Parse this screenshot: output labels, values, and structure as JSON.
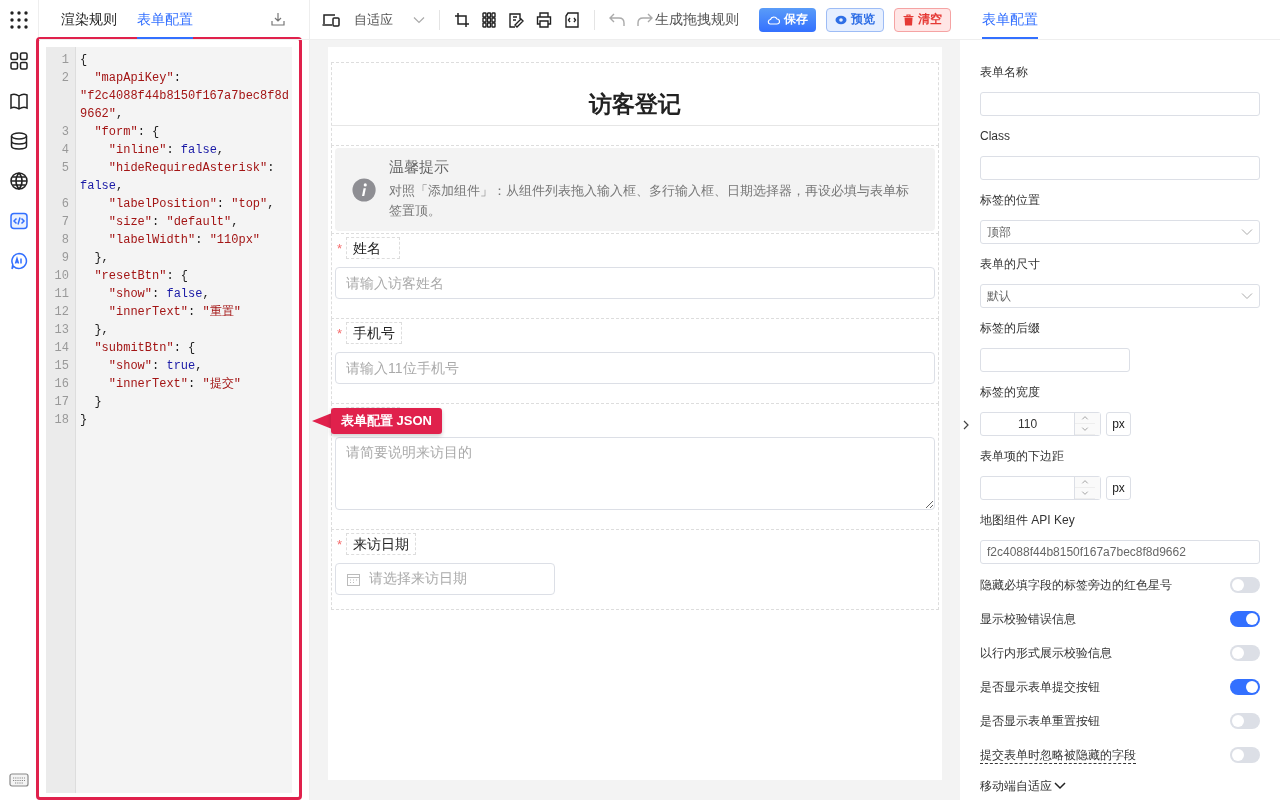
{
  "rail": {
    "items": [
      {
        "selected": false
      },
      {
        "selected": false
      },
      {
        "selected": false
      },
      {
        "selected": false
      },
      {
        "selected": true
      },
      {
        "selected": false
      }
    ]
  },
  "left_panel": {
    "tabs": [
      {
        "label": "渲染规则",
        "selected": false
      },
      {
        "label": "表单配置",
        "selected": true
      }
    ]
  },
  "code_editor": {
    "lines": [
      {
        "number": "1",
        "tokens": [
          {
            "kind": "punct",
            "text": "{"
          }
        ]
      },
      {
        "number": "2",
        "tokens": [
          {
            "kind": "key",
            "text": "  \"mapApiKey\""
          },
          {
            "kind": "punct",
            "text": ": "
          },
          {
            "kind": "string",
            "text": "\"f2c4088f44b8150f167a7bec8f8d9662\""
          },
          {
            "kind": "punct",
            "text": ","
          }
        ]
      },
      {
        "number": "3",
        "tokens": [
          {
            "kind": "key",
            "text": "  \"form\""
          },
          {
            "kind": "punct",
            "text": ": {"
          }
        ]
      },
      {
        "number": "4",
        "tokens": [
          {
            "kind": "key",
            "text": "    \"inline\""
          },
          {
            "kind": "punct",
            "text": ": "
          },
          {
            "kind": "literal",
            "text": "false"
          },
          {
            "kind": "punct",
            "text": ","
          }
        ]
      },
      {
        "number": "5",
        "tokens": [
          {
            "kind": "key",
            "text": "    \"hideRequiredAsterisk\""
          },
          {
            "kind": "punct",
            "text": ": "
          },
          {
            "kind": "literal",
            "text": "false"
          },
          {
            "kind": "punct",
            "text": ","
          }
        ]
      },
      {
        "number": "6",
        "tokens": [
          {
            "kind": "key",
            "text": "    \"labelPosition\""
          },
          {
            "kind": "punct",
            "text": ": "
          },
          {
            "kind": "string",
            "text": "\"top\""
          },
          {
            "kind": "punct",
            "text": ","
          }
        ]
      },
      {
        "number": "7",
        "tokens": [
          {
            "kind": "key",
            "text": "    \"size\""
          },
          {
            "kind": "punct",
            "text": ": "
          },
          {
            "kind": "string",
            "text": "\"default\""
          },
          {
            "kind": "punct",
            "text": ","
          }
        ]
      },
      {
        "number": "8",
        "tokens": [
          {
            "kind": "key",
            "text": "    \"labelWidth\""
          },
          {
            "kind": "punct",
            "text": ": "
          },
          {
            "kind": "string",
            "text": "\"110px\""
          }
        ]
      },
      {
        "number": "9",
        "tokens": [
          {
            "kind": "punct",
            "text": "  },"
          }
        ]
      },
      {
        "number": "10",
        "tokens": [
          {
            "kind": "key",
            "text": "  \"resetBtn\""
          },
          {
            "kind": "punct",
            "text": ": {"
          }
        ]
      },
      {
        "number": "11",
        "tokens": [
          {
            "kind": "key",
            "text": "    \"show\""
          },
          {
            "kind": "punct",
            "text": ": "
          },
          {
            "kind": "literal",
            "text": "false"
          },
          {
            "kind": "punct",
            "text": ","
          }
        ]
      },
      {
        "number": "12",
        "tokens": [
          {
            "kind": "key",
            "text": "    \"innerText\""
          },
          {
            "kind": "punct",
            "text": ": "
          },
          {
            "kind": "string",
            "text": "\"重置\""
          }
        ]
      },
      {
        "number": "13",
        "tokens": [
          {
            "kind": "punct",
            "text": "  },"
          }
        ]
      },
      {
        "number": "14",
        "tokens": [
          {
            "kind": "key",
            "text": "  \"submitBtn\""
          },
          {
            "kind": "punct",
            "text": ": {"
          }
        ]
      },
      {
        "number": "15",
        "tokens": [
          {
            "kind": "key",
            "text": "    \"show\""
          },
          {
            "kind": "punct",
            "text": ": "
          },
          {
            "kind": "literal",
            "text": "true"
          },
          {
            "kind": "punct",
            "text": ","
          }
        ]
      },
      {
        "number": "16",
        "tokens": [
          {
            "kind": "key",
            "text": "    \"innerText\""
          },
          {
            "kind": "punct",
            "text": ": "
          },
          {
            "kind": "string",
            "text": "\"提交\""
          }
        ]
      },
      {
        "number": "17",
        "tokens": [
          {
            "kind": "punct",
            "text": "  }"
          }
        ]
      },
      {
        "number": "18",
        "tokens": [
          {
            "kind": "punct",
            "text": "}"
          }
        ]
      }
    ]
  },
  "annotation": {
    "label": "表单配置 JSON"
  },
  "toolbar": {
    "device_select": {
      "value": "自适应"
    },
    "generate_label": "生成拖拽规则",
    "buttons": [
      {
        "label": "保存",
        "kind": "primary"
      },
      {
        "label": "预览",
        "kind": "info"
      },
      {
        "label": "清空",
        "kind": "danger"
      }
    ]
  },
  "form": {
    "title": "访客登记",
    "alert": {
      "title": "温馨提示",
      "description": "对照「添加组件」：从组件列表拖入输入框、多行输入框、日期选择器，再设必填与表单标签置顶。"
    },
    "fields": [
      {
        "kind": "input",
        "label": "姓名",
        "required_mark": "*",
        "placeholder": "请输入访客姓名"
      },
      {
        "kind": "input",
        "label": "手机号",
        "required_mark": "*",
        "placeholder": "请输入11位手机号"
      },
      {
        "kind": "textarea",
        "placeholder": "请简要说明来访目的"
      },
      {
        "kind": "date",
        "label": "来访日期",
        "required_mark": "*",
        "placeholder": "请选择来访日期"
      }
    ]
  },
  "right_panel": {
    "tabs": [
      {
        "label": "表单配置",
        "selected": true
      }
    ],
    "settings": [
      {
        "kind": "text",
        "label": "表单名称"
      },
      {
        "kind": "text",
        "label": "Class"
      },
      {
        "kind": "select",
        "label": "标签的位置",
        "value": "顶部"
      },
      {
        "kind": "select",
        "label": "表单的尺寸",
        "value": "默认"
      },
      {
        "kind": "short_text",
        "label": "标签的后缀"
      },
      {
        "kind": "number",
        "label": "标签的宽度",
        "value": "110",
        "unit": "px"
      },
      {
        "kind": "number",
        "label": "表单项的下边距",
        "unit": "px"
      },
      {
        "kind": "text",
        "label": "地图组件 API Key",
        "value": "f2c4088f44b8150f167a7bec8f8d9662"
      },
      {
        "kind": "switch",
        "label": "隐藏必填字段的标签旁边的红色星号",
        "on": false,
        "underlined": false
      },
      {
        "kind": "switch",
        "label": "显示校验错误信息",
        "on": true,
        "underlined": false
      },
      {
        "kind": "switch",
        "label": "以行内形式展示校验信息",
        "on": false,
        "underlined": false
      },
      {
        "kind": "switch",
        "label": "是否显示表单提交按钮",
        "on": true,
        "underlined": false
      },
      {
        "kind": "switch",
        "label": "是否显示表单重置按钮",
        "on": false,
        "underlined": false
      },
      {
        "kind": "switch",
        "label": "提交表单时忽略被隐藏的字段",
        "on": false,
        "underlined": true
      },
      {
        "kind": "collapse",
        "label": "移动端自适应",
        "expanded": false
      }
    ]
  }
}
